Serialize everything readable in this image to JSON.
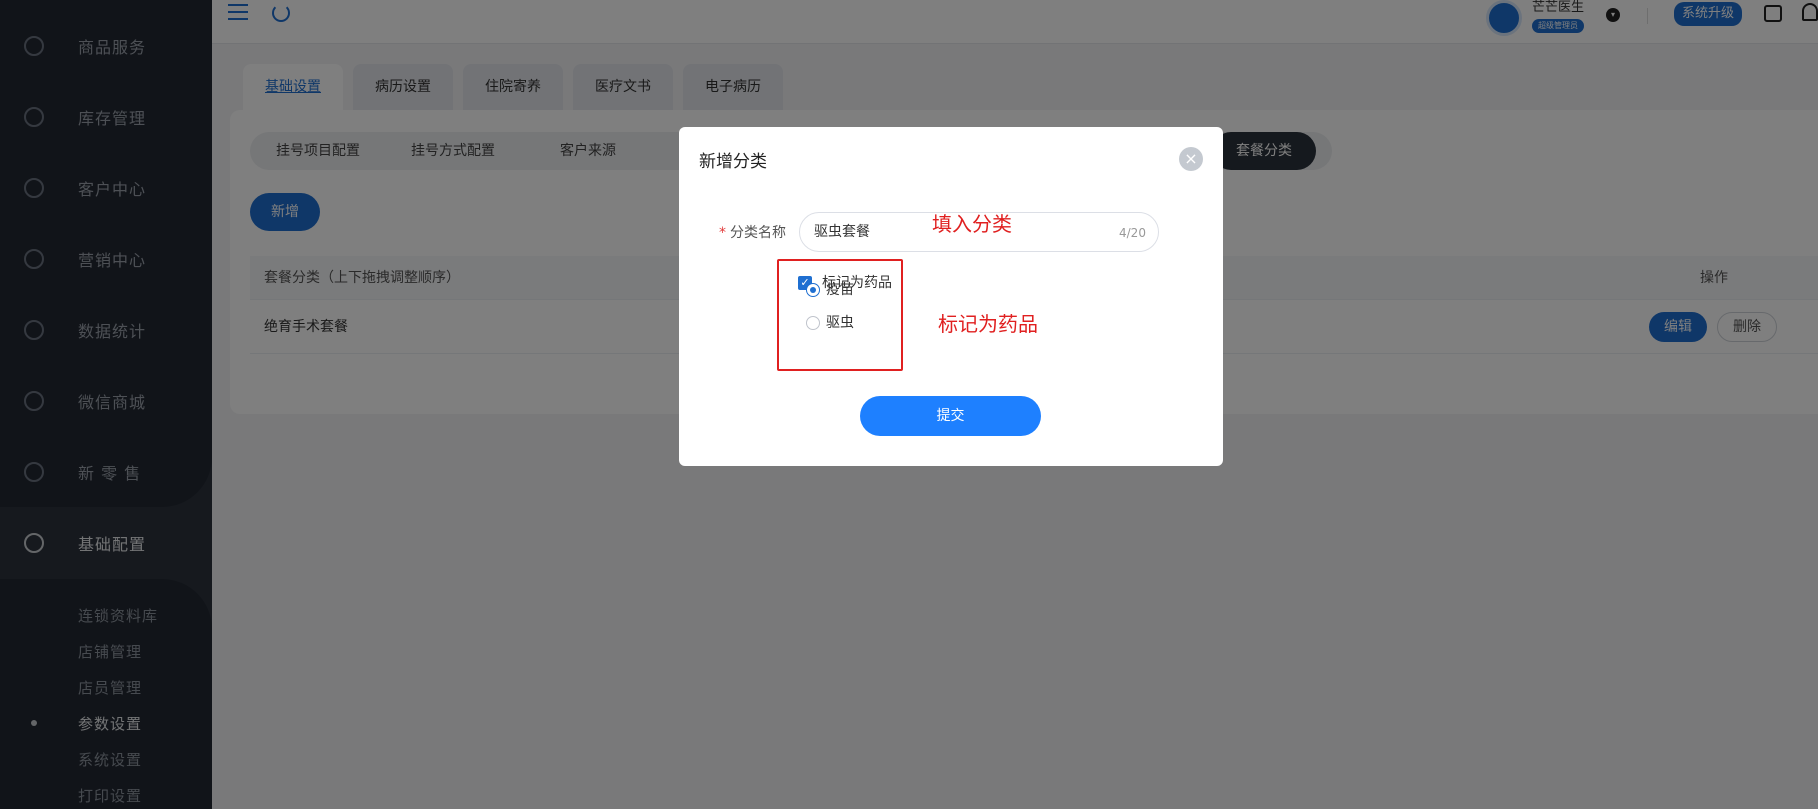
{
  "sidebar": {
    "items": [
      {
        "label": "商品服务",
        "icon": "bag-icon"
      },
      {
        "label": "库存管理",
        "icon": "box-icon"
      },
      {
        "label": "客户中心",
        "icon": "customer-icon"
      },
      {
        "label": "营销中心",
        "icon": "chart-icon"
      },
      {
        "label": "数据统计",
        "icon": "stats-icon"
      },
      {
        "label": "微信商城",
        "icon": "wechat-icon"
      },
      {
        "label": "新 零 售",
        "icon": "cube-icon"
      },
      {
        "label": "基础配置",
        "icon": "settings-icon"
      }
    ],
    "subitems": [
      {
        "label": "连锁资料库"
      },
      {
        "label": "店铺管理"
      },
      {
        "label": "店员管理"
      },
      {
        "label": "参数设置"
      },
      {
        "label": "系统设置"
      },
      {
        "label": "打印设置"
      }
    ]
  },
  "header": {
    "user_name": "芒芒医生",
    "role": "超级管理员",
    "upgrade_label": "系统升级"
  },
  "tabs": [
    {
      "label": "基础设置"
    },
    {
      "label": "病历设置"
    },
    {
      "label": "住院寄养"
    },
    {
      "label": "医疗文书"
    },
    {
      "label": "电子病历"
    }
  ],
  "subtabs": [
    {
      "label": "挂号项目配置"
    },
    {
      "label": "挂号方式配置"
    },
    {
      "label": "客户来源"
    },
    {
      "label": "套餐分类"
    }
  ],
  "actions": {
    "add_label": "新增"
  },
  "table": {
    "columns": [
      "套餐分类（上下拖拽调整顺序）",
      "操作"
    ],
    "rows": [
      {
        "name": "绝育手术套餐",
        "edit": "编辑",
        "delete": "删除"
      }
    ]
  },
  "modal": {
    "title": "新增分类",
    "name_label": "分类名称",
    "name_value": "驱虫套餐",
    "counter": "4/20",
    "checkbox_label": "标记为药品",
    "radio_options": [
      "疫苗",
      "驱虫"
    ],
    "selected": "疫苗",
    "submit_label": "提交"
  },
  "annotations": {
    "fill_name": "填入分类",
    "mark_drug": "标记为药品"
  },
  "colors": {
    "primary": "#1f6fd1",
    "annotation": "#e02020",
    "sidebar_bg": "#232933"
  }
}
